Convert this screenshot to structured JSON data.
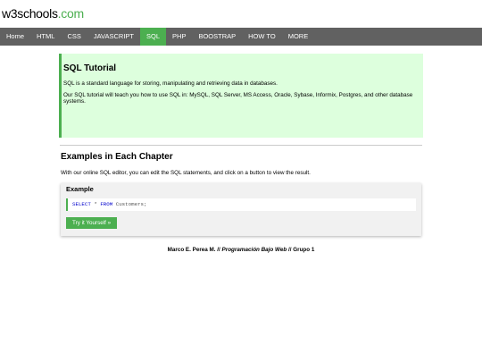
{
  "logo": {
    "part1": "w3",
    "part2": "schools",
    "part3": ".com"
  },
  "nav": {
    "items": [
      "Home",
      "HTML",
      "CSS",
      "JAVASCRIPT",
      "SQL",
      "PHP",
      "BOOSTRAP",
      "HOW TO",
      "MORE"
    ],
    "active": "SQL"
  },
  "intro": {
    "title": "SQL Tutorial",
    "p1": "SQL is a standard language for storing, manipulating and retrieving data in databases.",
    "p2": "Our SQL tutorial will teach you how to use SQL in: MySQL, SQL Server, MS Access, Oracle, Sybase, Informix, Postgres, and other database systems."
  },
  "examples": {
    "title": "Examples in Each Chapter",
    "text": "With our online SQL editor, you can edit the SQL statements, and click on a button to view the result.",
    "box_title": "Example",
    "code_select": "SELECT",
    "code_star": " * ",
    "code_from": "FROM",
    "code_rest": " Customers;",
    "try_button": "Try it Yourself »"
  },
  "footer": {
    "author": "Marco E. Perea M. // ",
    "course": "Programación Bajo Web",
    "group": " // Grupo 1"
  },
  "colors": {
    "accent": "#4caf50",
    "nav_bg": "#616161",
    "intro_bg": "#ddffdd"
  }
}
